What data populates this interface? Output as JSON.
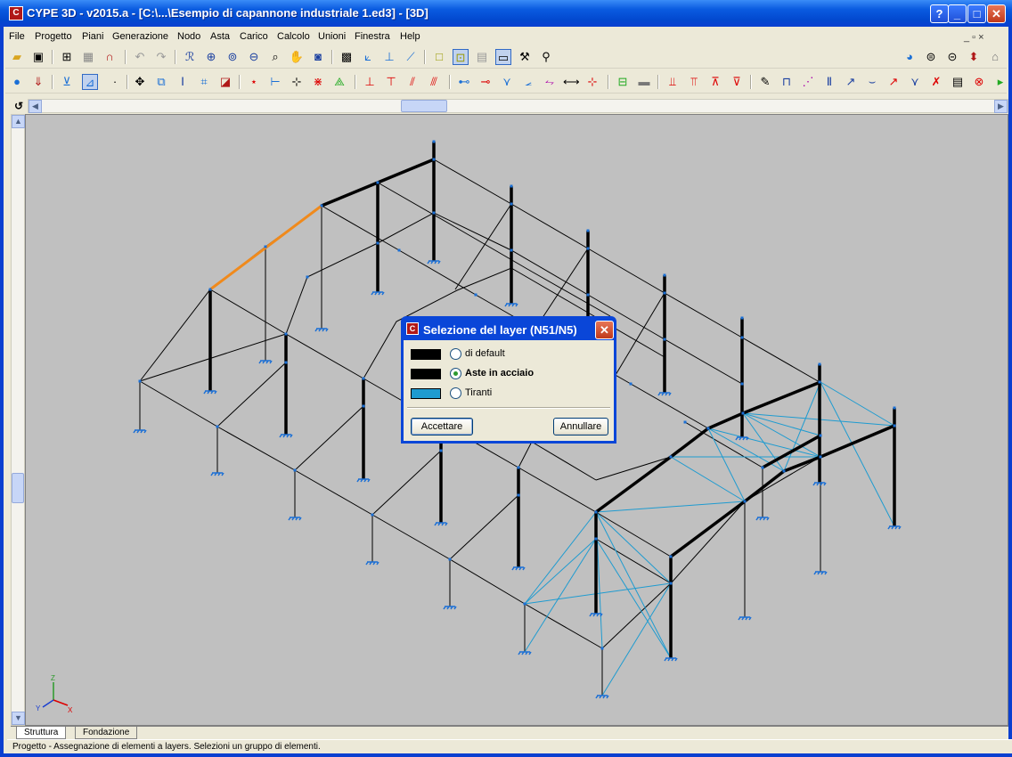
{
  "window": {
    "title": "CYPE 3D - v2015.a - [C:\\...\\Esempio di capannone industriale 1.ed3] - [3D]",
    "app_icon_label": "C"
  },
  "title_buttons": {
    "help": "?",
    "minimize": "_",
    "maximize": "□",
    "close": "✕"
  },
  "menu": [
    "File",
    "Progetto",
    "Piani",
    "Generazione",
    "Nodo",
    "Asta",
    "Carico",
    "Calcolo",
    "Unioni",
    "Finestra",
    "Help"
  ],
  "mdi_controls": "_ ▫ ×",
  "toolbar1_icons": [
    "open-folder",
    "save",
    "view",
    "print",
    "magnet",
    "undo",
    "redo",
    "select",
    "zoom-in",
    "zoom-window",
    "zoom-out",
    "zoom-fit",
    "pan",
    "orbit",
    "layers",
    "view-3d",
    "view-xz",
    "view-yz",
    "frame",
    "nodes",
    "grid",
    "tools",
    "binoculars"
  ],
  "tabs": [
    "Struttura",
    "Fondazione"
  ],
  "status": "Progetto - Assegnazione di elementi a layers.  Selezioni un gruppo di elementi.",
  "dialog": {
    "title": "Selezione del layer (N51/N5)",
    "options": [
      {
        "label": "di default",
        "color": "#000000",
        "selected": false
      },
      {
        "label": "Aste in acciaio",
        "color": "#000000",
        "selected": true
      },
      {
        "label": "Tiranti",
        "color": "#1e9bd0",
        "selected": false
      }
    ],
    "accept": "Accettare",
    "cancel": "Annullare"
  },
  "axes": {
    "z": "Z",
    "x": "X",
    "y": "Y"
  },
  "colors": {
    "structure": "#000000",
    "bracing": "#1e9bd0",
    "node": "#1a6fd6",
    "selected": "#f08a1c"
  }
}
